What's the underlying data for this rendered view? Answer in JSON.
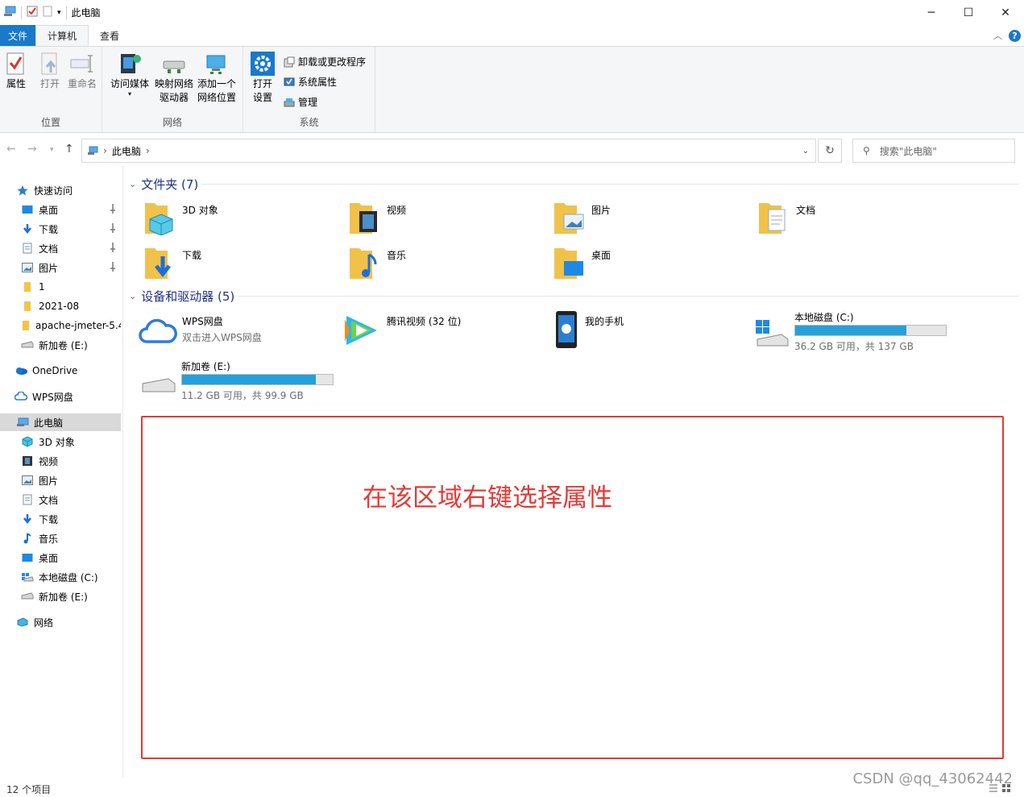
{
  "window": {
    "title": "此电脑"
  },
  "tabs": {
    "file": "文件",
    "computer": "计算机",
    "view": "查看"
  },
  "ribbon": {
    "location": {
      "properties": "属性",
      "open": "打开",
      "rename": "重命名",
      "label": "位置"
    },
    "network": {
      "media": "访问媒体",
      "map_drive_1": "映射网络",
      "map_drive_2": "驱动器",
      "add_location_1": "添加一个",
      "add_location_2": "网络位置",
      "label": "网络"
    },
    "system": {
      "open_settings_1": "打开",
      "open_settings_2": "设置",
      "uninstall": "卸载或更改程序",
      "sys_props": "系统属性",
      "manage": "管理",
      "label": "系统"
    }
  },
  "address": {
    "path": "此电脑",
    "search_placeholder": "搜索\"此电脑\""
  },
  "sidebar": {
    "items": [
      {
        "label": "快速访问"
      },
      {
        "label": "桌面"
      },
      {
        "label": "下载"
      },
      {
        "label": "文档"
      },
      {
        "label": "图片"
      },
      {
        "label": "1"
      },
      {
        "label": "2021-08"
      },
      {
        "label": "apache-jmeter-5.4"
      },
      {
        "label": "新加卷 (E:)"
      },
      {
        "label": "OneDrive"
      },
      {
        "label": "WPS网盘"
      },
      {
        "label": "此电脑"
      },
      {
        "label": "3D 对象"
      },
      {
        "label": "视频"
      },
      {
        "label": "图片"
      },
      {
        "label": "文档"
      },
      {
        "label": "下载"
      },
      {
        "label": "音乐"
      },
      {
        "label": "桌面"
      },
      {
        "label": "本地磁盘 (C:)"
      },
      {
        "label": "新加卷 (E:)"
      },
      {
        "label": "网络"
      }
    ]
  },
  "folders": {
    "heading": "文件夹 (7)",
    "items": [
      {
        "label": "3D 对象"
      },
      {
        "label": "视频"
      },
      {
        "label": "图片"
      },
      {
        "label": "文档"
      },
      {
        "label": "下载"
      },
      {
        "label": "音乐"
      },
      {
        "label": "桌面"
      }
    ]
  },
  "devices": {
    "heading": "设备和驱动器 (5)",
    "wps": {
      "name": "WPS网盘",
      "sub": "双击进入WPS网盘"
    },
    "tencent": {
      "name": "腾讯视频 (32 位)"
    },
    "phone": {
      "name": "我的手机"
    },
    "c_drive": {
      "name": "本地磁盘 (C:)",
      "cap": "36.2 GB 可用，共 137 GB",
      "used_fraction": 0.736
    },
    "e_drive": {
      "name": "新加卷 (E:)",
      "cap": "11.2 GB 可用，共 99.9 GB",
      "used_fraction": 0.888
    }
  },
  "annotation": "在该区域右键选择属性",
  "status": "12 个项目",
  "watermark": "CSDN @qq_43062442",
  "colors": {
    "accent": "#1979ca",
    "annotation": "#e53935",
    "drive_fill": "#26a0da"
  }
}
